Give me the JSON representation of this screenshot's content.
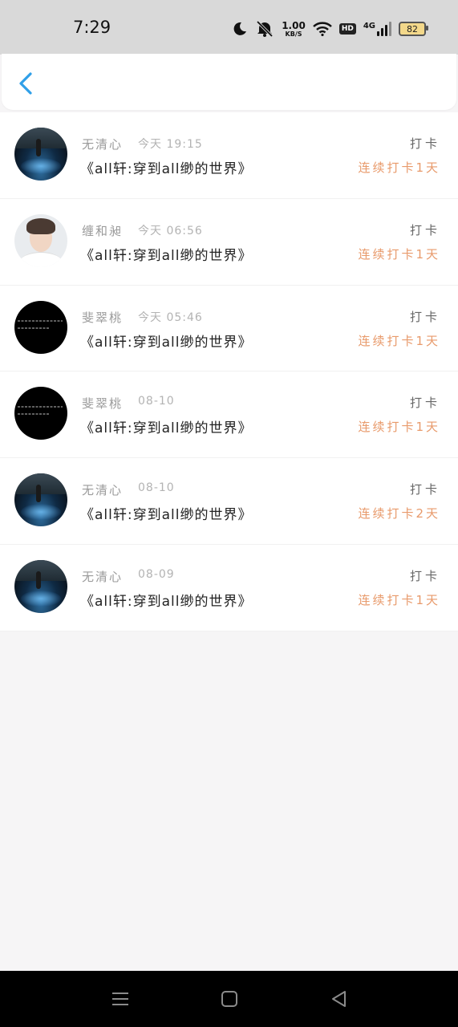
{
  "status_bar": {
    "time": "7:29",
    "net_speed_value": "1.00",
    "net_speed_unit": "KB/S",
    "hd_label": "HD",
    "network_label": "4G",
    "battery_level": "82",
    "icons": [
      "moon-icon",
      "mute-icon",
      "wifi-icon",
      "hd-icon",
      "signal-icon",
      "battery-icon"
    ]
  },
  "header": {
    "back_icon": "chevron-left-icon",
    "accent_color": "#2f9fe8"
  },
  "items": [
    {
      "name": "无清心",
      "time": "今天 19:15",
      "title": "《all轩:穿到all缈的世界》",
      "action": "打卡",
      "streak": "连续打卡1天",
      "avatar": "scenic"
    },
    {
      "name": "缠和昶",
      "time": "今天 06:56",
      "title": "《all轩:穿到all缈的世界》",
      "action": "打卡",
      "streak": "连续打卡1天",
      "avatar": "person"
    },
    {
      "name": "斐翠桃",
      "time": "今天 05:46",
      "title": "《all轩:穿到all缈的世界》",
      "action": "打卡",
      "streak": "连续打卡1天",
      "avatar": "dark"
    },
    {
      "name": "斐翠桃",
      "time": "08-10",
      "title": "《all轩:穿到all缈的世界》",
      "action": "打卡",
      "streak": "连续打卡1天",
      "avatar": "dark"
    },
    {
      "name": "无清心",
      "time": "08-10",
      "title": "《all轩:穿到all缈的世界》",
      "action": "打卡",
      "streak": "连续打卡2天",
      "avatar": "scenic"
    },
    {
      "name": "无清心",
      "time": "08-09",
      "title": "《all轩:穿到all缈的世界》",
      "action": "打卡",
      "streak": "连续打卡1天",
      "avatar": "scenic"
    }
  ],
  "nav_bar": {
    "icons": [
      "menu-icon",
      "home-icon",
      "back-triangle-icon"
    ]
  },
  "colors": {
    "streak": "#e89a6b",
    "background": "#f6f5f6",
    "status_bar": "#d9d9d9",
    "nav_bar": "#000000"
  }
}
